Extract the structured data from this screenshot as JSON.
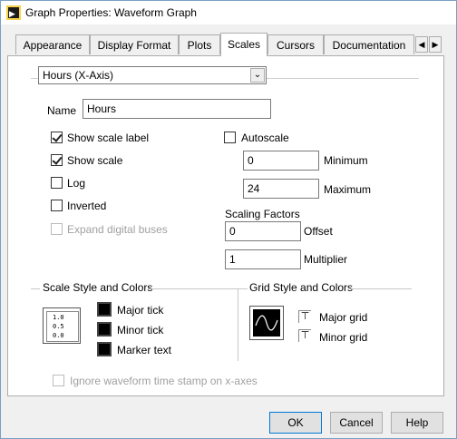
{
  "window": {
    "title": "Graph Properties: Waveform Graph"
  },
  "tabs": [
    {
      "label": "Appearance"
    },
    {
      "label": "Display Format"
    },
    {
      "label": "Plots"
    },
    {
      "label": "Scales"
    },
    {
      "label": "Cursors"
    },
    {
      "label": "Documentation"
    }
  ],
  "active_tab": "Scales",
  "scale_select": {
    "value": "Hours (X-Axis)"
  },
  "name": {
    "label": "Name",
    "value": "Hours"
  },
  "options": {
    "show_scale_label": {
      "label": "Show scale label",
      "checked": true
    },
    "show_scale": {
      "label": "Show scale",
      "checked": true
    },
    "log": {
      "label": "Log",
      "checked": false
    },
    "inverted": {
      "label": "Inverted",
      "checked": false
    },
    "expand_digital_buses": {
      "label": "Expand digital buses",
      "checked": false,
      "disabled": true
    },
    "autoscale": {
      "label": "Autoscale",
      "checked": false
    }
  },
  "range": {
    "minimum": {
      "label": "Minimum",
      "value": "0"
    },
    "maximum": {
      "label": "Maximum",
      "value": "24"
    }
  },
  "scaling_factors": {
    "title": "Scaling Factors",
    "offset": {
      "label": "Offset",
      "value": "0"
    },
    "multiplier": {
      "label": "Multiplier",
      "value": "1"
    }
  },
  "scale_style": {
    "title": "Scale Style and Colors",
    "icon_ticks": [
      "1.0",
      "0.5",
      "0.0"
    ],
    "colors": [
      {
        "label": "Major tick",
        "color": "#000000"
      },
      {
        "label": "Minor tick",
        "color": "#000000"
      },
      {
        "label": "Marker text",
        "color": "#000000"
      }
    ]
  },
  "grid_style": {
    "title": "Grid Style and Colors",
    "items": [
      {
        "label": "Major grid",
        "icon": "grid-line-icon"
      },
      {
        "label": "Minor grid",
        "icon": "grid-line-icon"
      }
    ]
  },
  "ignore_timestamp": {
    "label": "Ignore waveform time stamp on x-axes",
    "checked": false,
    "disabled": true
  },
  "buttons": {
    "ok": "OK",
    "cancel": "Cancel",
    "help": "Help"
  }
}
